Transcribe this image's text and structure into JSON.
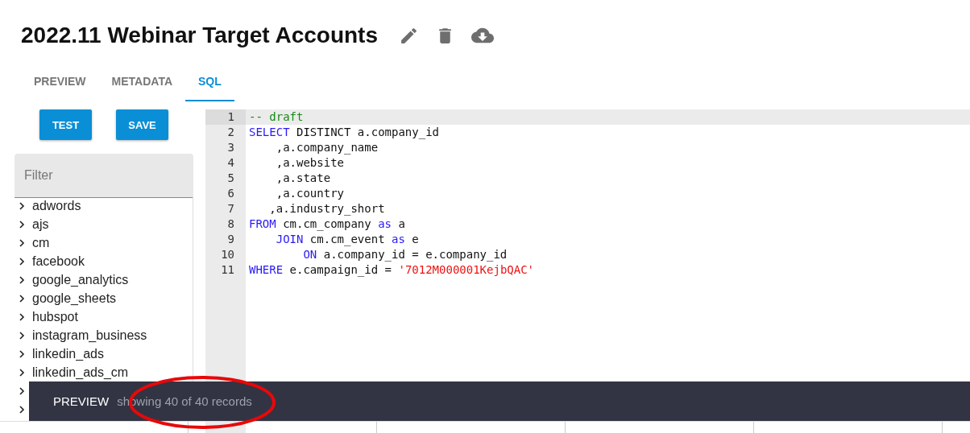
{
  "title": "2022.11 Webinar Target Accounts",
  "tabs": [
    {
      "label": "PREVIEW",
      "selected": false
    },
    {
      "label": "METADATA",
      "selected": false
    },
    {
      "label": "SQL",
      "selected": true
    }
  ],
  "buttons": [
    "TEST",
    "SAVE"
  ],
  "filter": {
    "placeholder": "Filter"
  },
  "tree": [
    {
      "label": "adwords",
      "expanded": false
    },
    {
      "label": "ajs",
      "expanded": false
    },
    {
      "label": "cm",
      "expanded": false
    },
    {
      "label": "facebook",
      "expanded": false
    },
    {
      "label": "google_analytics",
      "expanded": false
    },
    {
      "label": "google_sheets",
      "expanded": false
    },
    {
      "label": "hubspot",
      "expanded": false
    },
    {
      "label": "instagram_business",
      "expanded": false
    },
    {
      "label": "linkedin_ads",
      "expanded": false
    },
    {
      "label": "linkedin_ads_cm",
      "expanded": false
    },
    {
      "expanded": false
    },
    {
      "expanded": false
    }
  ],
  "editor": {
    "lines": [
      {
        "number": "1",
        "active": true,
        "tokens": [
          {
            "kind": "comment",
            "text": "-- draft"
          }
        ]
      },
      {
        "number": "2",
        "active": false,
        "tokens": [
          {
            "kind": "keyword",
            "text": "SELECT"
          },
          {
            "kind": "plain",
            "text": " DISTINCT a.company_id"
          }
        ]
      },
      {
        "number": "3",
        "active": false,
        "tokens": [
          {
            "kind": "plain",
            "text": "    ,a.company_name"
          }
        ]
      },
      {
        "number": "4",
        "active": false,
        "tokens": [
          {
            "kind": "plain",
            "text": "    ,a.website"
          }
        ]
      },
      {
        "number": "5",
        "active": false,
        "tokens": [
          {
            "kind": "plain",
            "text": "    ,a.state"
          }
        ]
      },
      {
        "number": "6",
        "active": false,
        "tokens": [
          {
            "kind": "plain",
            "text": "    ,a.country"
          }
        ]
      },
      {
        "number": "7",
        "active": false,
        "tokens": [
          {
            "kind": "plain",
            "text": "   ,a.industry_short"
          }
        ]
      },
      {
        "number": "8",
        "active": false,
        "tokens": [
          {
            "kind": "keyword",
            "text": "FROM"
          },
          {
            "kind": "plain",
            "text": " cm.cm_company "
          },
          {
            "kind": "keyword",
            "text": "as"
          },
          {
            "kind": "plain",
            "text": " a"
          }
        ]
      },
      {
        "number": "9",
        "active": false,
        "tokens": [
          {
            "kind": "keyword",
            "text": "    JOIN"
          },
          {
            "kind": "plain",
            "text": " cm.cm_event "
          },
          {
            "kind": "keyword",
            "text": "as"
          },
          {
            "kind": "plain",
            "text": " e"
          }
        ]
      },
      {
        "number": "10",
        "active": false,
        "tokens": [
          {
            "kind": "keyword",
            "text": "        ON"
          },
          {
            "kind": "plain",
            "text": " a.company_id = e.company_id"
          }
        ]
      },
      {
        "number": "11",
        "active": false,
        "tokens": [
          {
            "kind": "keyword",
            "text": "WHERE"
          },
          {
            "kind": "plain",
            "text": " e.campaign_id = "
          },
          {
            "kind": "string",
            "text": "'7012M000001KejbQAC'"
          }
        ]
      }
    ]
  },
  "preview_bar": {
    "title": "PREVIEW",
    "status": "showing 40 of 40 records"
  },
  "annotations": [
    {
      "kind": "ellipse"
    }
  ]
}
